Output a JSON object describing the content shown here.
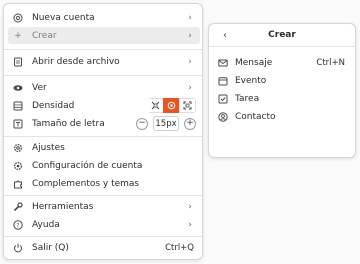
{
  "menu": {
    "new_account": "Nueva cuenta",
    "create": "Crear",
    "open_file": "Abrir desde archivo",
    "view": "Ver",
    "density": "Densidad",
    "font_size": "Tamaño de letra",
    "font_size_value": "15px",
    "zoom_out": "−",
    "zoom_in": "+",
    "settings": "Ajustes",
    "account_settings": "Configuración de cuenta",
    "addons": "Complementos y temas",
    "tools": "Herramientas",
    "help": "Ayuda",
    "quit": "Salir (Q)",
    "quit_shortcut": "Ctrl+Q",
    "density_active": "normal"
  },
  "submenu": {
    "title": "Crear",
    "items": [
      {
        "label": "Mensaje",
        "shortcut": "Ctrl+N",
        "icon": "envelope-icon"
      },
      {
        "label": "Evento",
        "shortcut": "",
        "icon": "calendar-icon"
      },
      {
        "label": "Tarea",
        "shortcut": "",
        "icon": "task-icon"
      },
      {
        "label": "Contacto",
        "shortcut": "",
        "icon": "contact-icon"
      }
    ]
  },
  "colors": {
    "accent": "#e95420",
    "highlight": "#ececec"
  }
}
